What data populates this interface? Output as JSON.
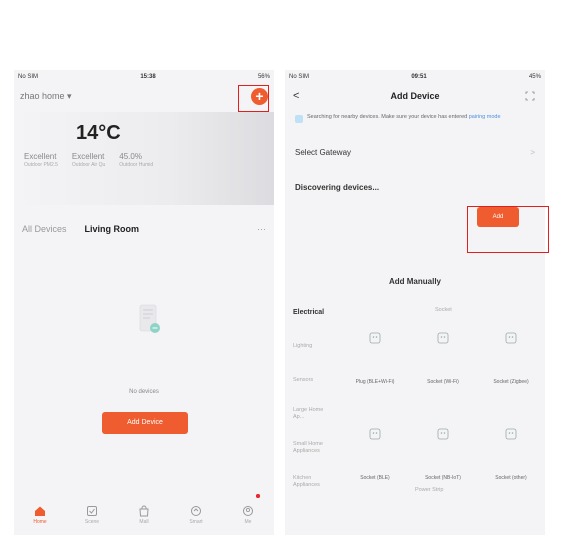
{
  "left": {
    "status": {
      "carrier": "No SIM",
      "time": "15:38",
      "battery": "56%"
    },
    "home_name": "zhao home",
    "add_symbol": "+",
    "weather": {
      "temperature": "14°C",
      "stats": [
        {
          "value": "Excellent",
          "label": "Outdoor PM2.5"
        },
        {
          "value": "Excellent",
          "label": "Outdoor Air Qu"
        },
        {
          "value": "45.0%",
          "label": "Outdoor Humid"
        }
      ]
    },
    "rooms": [
      "All Devices",
      "Living Room"
    ],
    "more": "···",
    "empty_text": "No devices",
    "add_device_label": "Add Device",
    "tabs": [
      {
        "icon": "home-icon",
        "label": "Home"
      },
      {
        "icon": "scene-icon",
        "label": "Scene"
      },
      {
        "icon": "mall-icon",
        "label": "Mall"
      },
      {
        "icon": "smart-icon",
        "label": "Smart"
      },
      {
        "icon": "me-icon",
        "label": "Me"
      }
    ],
    "accent": "#ee5c2f"
  },
  "right": {
    "status": {
      "carrier": "No SIM",
      "time": "09:51",
      "battery": "45%"
    },
    "title": "Add Device",
    "back_symbol": "<",
    "notice": "Searching for nearby devices. Make sure your device has entered",
    "notice_link": "pairing mode",
    "gateway_label": "Select Gateway",
    "chevron": ">",
    "discovering_label": "Discovering devices...",
    "add_label": "Add",
    "manually_title": "Add Manually",
    "catalog": {
      "active_category": "Electrical",
      "sub_header": "Socket",
      "categories": [
        "Lighting",
        "Sensors",
        "Large Home Ap...",
        "Small Home Appliances",
        "Kitchen Appliances"
      ],
      "devices": [
        {
          "label": ""
        },
        {
          "label": ""
        },
        {
          "label": ""
        },
        {
          "label": "Plug (BLE+Wi-Fi)"
        },
        {
          "label": "Socket (Wi-Fi)"
        },
        {
          "label": "Socket (Zigbee)"
        },
        {
          "label": ""
        },
        {
          "label": ""
        },
        {
          "label": ""
        },
        {
          "label": "Socket (BLE)"
        },
        {
          "label": "Socket (NB-IoT)"
        },
        {
          "label": "Socket (other)"
        }
      ],
      "bottom_text": "Power Strip"
    }
  }
}
